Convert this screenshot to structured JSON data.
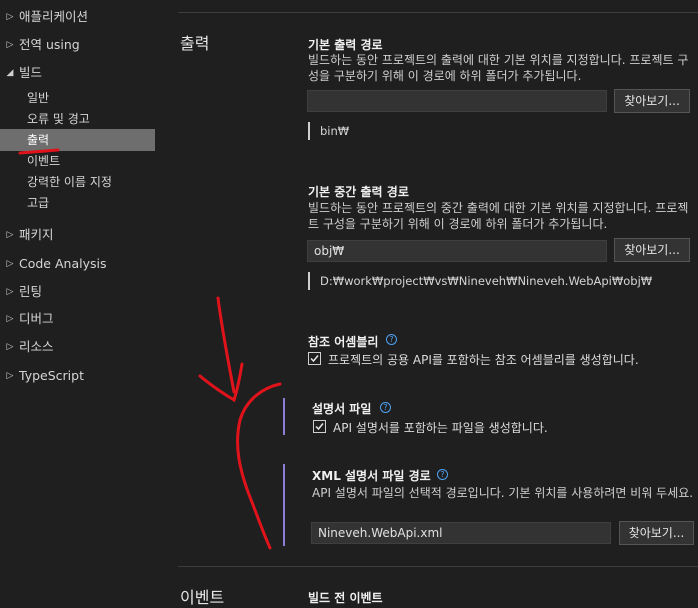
{
  "sidebar": {
    "items": [
      {
        "label": "애플리케이션"
      },
      {
        "label": "전역 using"
      },
      {
        "label": "빌드"
      },
      {
        "label": "일반"
      },
      {
        "label": "오류 및 경고"
      },
      {
        "label": "출력"
      },
      {
        "label": "이벤트"
      },
      {
        "label": "강력한 이름 지정"
      },
      {
        "label": "고급"
      },
      {
        "label": "패키지"
      },
      {
        "label": "Code Analysis"
      },
      {
        "label": "린팅"
      },
      {
        "label": "디버그"
      },
      {
        "label": "리소스"
      },
      {
        "label": "TypeScript"
      }
    ]
  },
  "section": {
    "title": "출력",
    "next_title": "이벤트"
  },
  "base_output": {
    "title": "기본 출력 경로",
    "desc": "빌드하는 동안 프로젝트의 출력에 대한 기본 위치를 지정합니다. 프로젝트 구성을 구분하기 위해 이 경로에 하위 폴더가 추가됩니다.",
    "value": "",
    "browse": "찾아보기...",
    "preview": "bin₩"
  },
  "base_intermediate": {
    "title": "기본 중간 출력 경로",
    "desc": "빌드하는 동안 프로젝트의 중간 출력에 대한 기본 위치를 지정합니다. 프로젝트 구성을 구분하기 위해 이 경로에 하위 폴더가 추가됩니다.",
    "value": "obj₩",
    "browse": "찾아보기...",
    "preview": "D:₩work₩project₩vs₩Nineveh₩Nineveh.WebApi₩obj₩"
  },
  "ref_assembly": {
    "title": "참조 어셈블리",
    "checkbox_label": "프로젝트의 공용 API를 포함하는 참조 어셈블리를 생성합니다.",
    "checked": true
  },
  "doc_file": {
    "title": "설명서 파일",
    "checkbox_label": "API 설명서를 포함하는 파일을 생성합니다.",
    "checked": true
  },
  "xml_doc_path": {
    "title": "XML 설명서 파일 경로",
    "desc": "API 설명서 파일의 선택적 경로입니다. 기본 위치를 사용하려면 비워 두세요.",
    "value": "Nineveh.WebApi.xml",
    "browse": "찾아보기..."
  },
  "next_section": {
    "title": "빌드 전 이벤트"
  },
  "icons": {
    "expand": "chevron-right-icon",
    "expanded": "chevron-down-icon",
    "help": "help-circle-icon",
    "check": "checkmark-icon"
  },
  "colors": {
    "background": "#1f1f1f",
    "selected": "#6e6e6e",
    "indent_bar": "#8a7fd4",
    "help": "#4ea1f3",
    "annotation": "#e0131b"
  }
}
